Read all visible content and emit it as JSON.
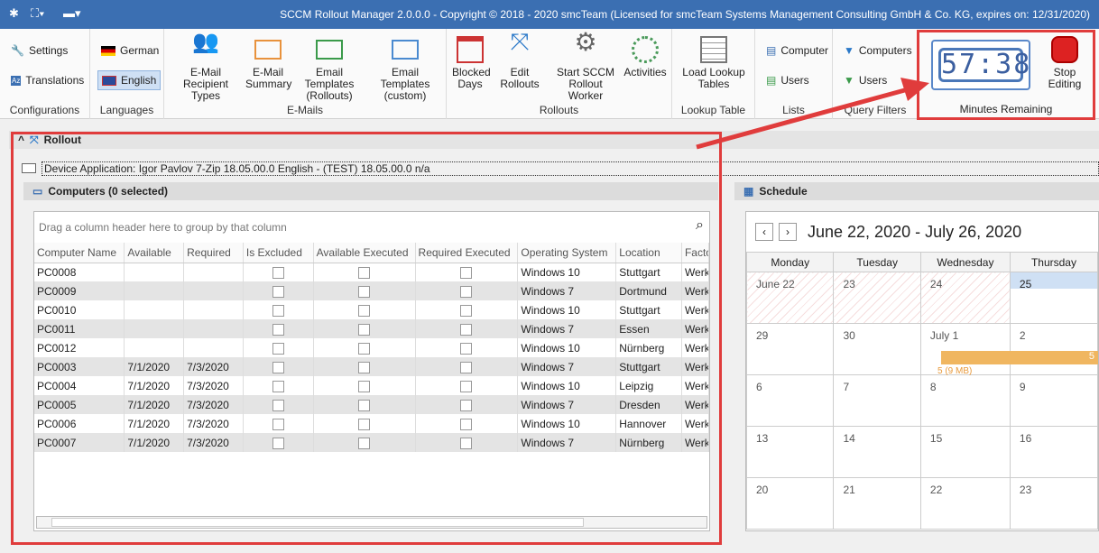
{
  "title": "SCCM Rollout Manager 2.0.0.0 - Copyright © 2018 - 2020 smcTeam (Licensed for smcTeam Systems Management Consulting GmbH & Co. KG, expires on: 12/31/2020)",
  "ribbon": {
    "configurations": {
      "label": "Configurations",
      "settings": "Settings",
      "translations": "Translations"
    },
    "languages": {
      "label": "Languages",
      "german": "German",
      "english": "English"
    },
    "emails": {
      "label": "E-Mails",
      "recipient": "E-Mail Recipient Types",
      "summary": "E-Mail Summary",
      "tpl_rollouts": "Email Templates (Rollouts)",
      "tpl_custom": "Email Templates (custom)"
    },
    "rollouts": {
      "label": "Rollouts",
      "blocked": "Blocked Days",
      "edit": "Edit Rollouts",
      "start": "Start SCCM Rollout Worker",
      "activities": "Activities"
    },
    "lookup": {
      "label": "Lookup Table",
      "load": "Load Lookup Tables"
    },
    "lists": {
      "label": "Lists",
      "computer": "Computer",
      "users": "Users"
    },
    "queries": {
      "label": "Query Filters",
      "computers": "Computers",
      "users": "Users"
    },
    "timer": {
      "label": "Minutes Remaining",
      "value": "57:38",
      "stop": "Stop Editing"
    }
  },
  "rollout": {
    "header": "Rollout",
    "application": "Device Application: Igor Pavlov 7-Zip 18.05.00.0 English - (TEST) 18.05.00.0 n/a"
  },
  "computers": {
    "header": "Computers (0 selected)",
    "group_hint": "Drag a column header here to group by that column",
    "columns": [
      "Computer Name",
      "Available",
      "Required",
      "Is Excluded",
      "Available Executed",
      "Required Executed",
      "Operating System",
      "Location",
      "Facto"
    ],
    "rows": [
      [
        "PC0008",
        "",
        "",
        "",
        "",
        "",
        "Windows 10",
        "Stuttgart",
        "Werk"
      ],
      [
        "PC0009",
        "",
        "",
        "",
        "",
        "",
        "Windows 7",
        "Dortmund",
        "Werk"
      ],
      [
        "PC0010",
        "",
        "",
        "",
        "",
        "",
        "Windows 10",
        "Stuttgart",
        "Werk"
      ],
      [
        "PC0011",
        "",
        "",
        "",
        "",
        "",
        "Windows 7",
        "Essen",
        "Werk"
      ],
      [
        "PC0012",
        "",
        "",
        "",
        "",
        "",
        "Windows 10",
        "Nürnberg",
        "Werk"
      ],
      [
        "PC0003",
        "7/1/2020",
        "7/3/2020",
        "",
        "",
        "",
        "Windows 7",
        "Stuttgart",
        "Werk"
      ],
      [
        "PC0004",
        "7/1/2020",
        "7/3/2020",
        "",
        "",
        "",
        "Windows 10",
        "Leipzig",
        "Werk"
      ],
      [
        "PC0005",
        "7/1/2020",
        "7/3/2020",
        "",
        "",
        "",
        "Windows 7",
        "Dresden",
        "Werk"
      ],
      [
        "PC0006",
        "7/1/2020",
        "7/3/2020",
        "",
        "",
        "",
        "Windows 10",
        "Hannover",
        "Werk"
      ],
      [
        "PC0007",
        "7/1/2020",
        "7/3/2020",
        "",
        "",
        "",
        "Windows 7",
        "Nürnberg",
        "Werk"
      ]
    ]
  },
  "schedule": {
    "header": "Schedule",
    "range": "June 22, 2020 - July 26, 2020",
    "days": [
      "Monday",
      "Tuesday",
      "Wednesday",
      "Thursday"
    ],
    "weeks": [
      [
        "June 22",
        "23",
        "24",
        "25"
      ],
      [
        "29",
        "30",
        "July 1",
        "2"
      ],
      [
        "6",
        "7",
        "8",
        "9"
      ],
      [
        "13",
        "14",
        "15",
        "16"
      ],
      [
        "20",
        "21",
        "22",
        "23"
      ]
    ],
    "event_count": "5",
    "event_size": "5 (9 MB)"
  }
}
